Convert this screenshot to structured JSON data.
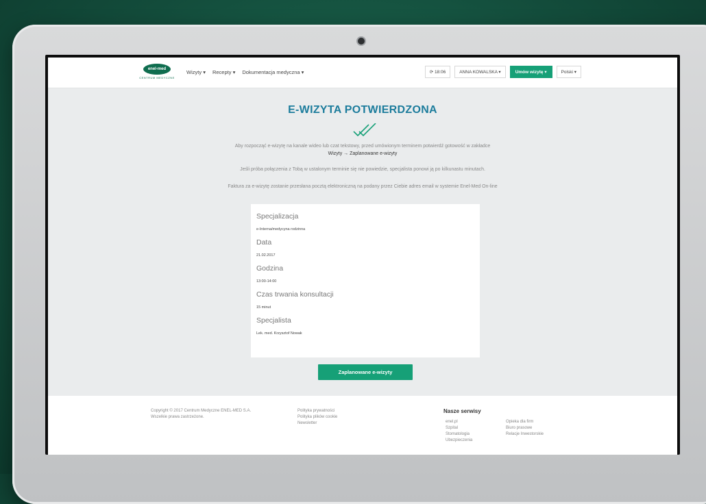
{
  "header": {
    "logo_text": "enel-med",
    "logo_sub": "CENTRUM MEDYCZNE",
    "nav": [
      "Wizyty",
      "Recepty",
      "Dokumentacja medyczna"
    ],
    "timer": "18:06",
    "user": "ANNA KOWALSKA",
    "book_button": "Umów wizytę",
    "language": "Polski"
  },
  "main": {
    "title": "E-WIZYTA POTWIERDZONA",
    "para1": "Aby rozpocząć e-wizytę na kanale wideo lub czat tekstowy, przed umówionym terminem potwierdź gotowość w zakładce",
    "para1_path": "Wizyty → Zaplanowane e-wizyty",
    "para2": "Jeśli próba połączenia z Tobą w ustalonym terminie się nie powiedzie, specjalista ponowi ją po kilkunastu minutach.",
    "para3": "Faktura za e-wizytę zostanie przesłana pocztą elektroniczną na podany przez Ciebie adres email w systemie Enel-Med On-line"
  },
  "details": [
    {
      "label": "Specjalizacja",
      "value": "e-Interna/medycyna rodzinna"
    },
    {
      "label": "Data",
      "value": "21.02.2017"
    },
    {
      "label": "Godzina",
      "value": "13:00-14:00"
    },
    {
      "label": "Czas trwania konsultacji",
      "value": "15 minut"
    },
    {
      "label": "Specjalista",
      "value": "Lek. med. Krzysztof Nowak"
    }
  ],
  "cta": "Zaplanowane e-wizyty",
  "footer": {
    "copyright": "Copyright © 2017 Centrum Medyczne ENEL-MED S.A.",
    "rights": "Wszelkie prawa zastrzeżone.",
    "links": [
      "Polityka prywatności",
      "Polityka plików cookie",
      "Newsletter"
    ],
    "services_title": "Nasze serwisy",
    "services_a": [
      "enel.pl",
      "Szpital",
      "Stomatologia",
      "Ubezpieczenia"
    ],
    "services_b": [
      "Opieka dla firm",
      "Biuro prasowe",
      "Relacje Inwestorskie"
    ]
  },
  "colors": {
    "accent": "#16a077",
    "title": "#1c7c9c"
  }
}
